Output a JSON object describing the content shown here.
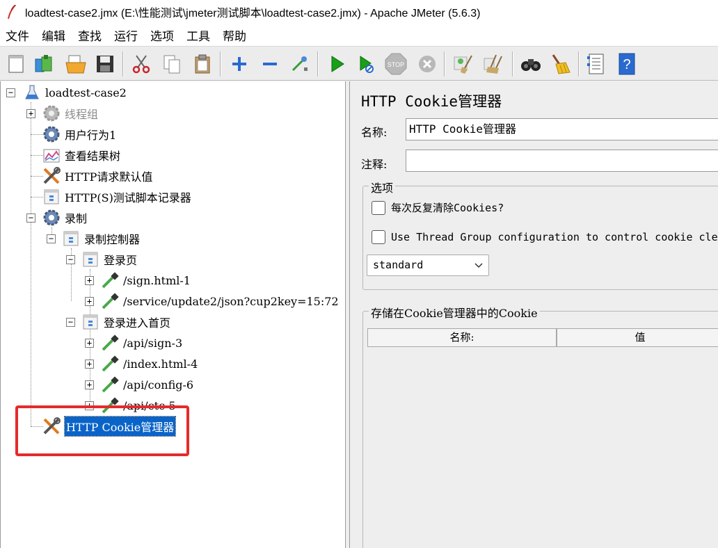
{
  "window": {
    "title": "loadtest-case2.jmx (E:\\性能测试\\jmeter测试脚本\\loadtest-case2.jmx) - Apache JMeter (5.6.3)"
  },
  "menu": [
    "文件",
    "编辑",
    "查找",
    "运行",
    "选项",
    "工具",
    "帮助"
  ],
  "toolbar": {
    "buttons": [
      "new-icon",
      "templates-icon",
      "open-icon",
      "save-icon",
      "cut-icon",
      "copy-icon",
      "paste-icon",
      "expand-icon",
      "collapse-icon",
      "toggle-icon",
      "start-icon",
      "start-no-pause-icon",
      "stop-icon",
      "shutdown-icon",
      "clear-icon",
      "clear-all-icon",
      "search-icon",
      "reset-search-icon",
      "function-helper-icon",
      "help-icon"
    ]
  },
  "tree": {
    "root": "loadtest-case2",
    "items": [
      {
        "label": "线程组",
        "icon": "gear-icon",
        "disabled": true
      },
      {
        "label": "用户行为1",
        "icon": "gear-icon"
      },
      {
        "label": "查看结果树",
        "icon": "chart-icon"
      },
      {
        "label": "HTTP请求默认值",
        "icon": "wrench-icon"
      },
      {
        "label": "HTTP(S)测试脚本记录器",
        "icon": "document-icon"
      },
      {
        "label": "录制",
        "icon": "gear-icon"
      },
      {
        "label": "录制控制器",
        "icon": "controller-icon"
      },
      {
        "label": "登录页",
        "icon": "controller-icon"
      },
      {
        "label": "/sign.html-1",
        "icon": "pipette-icon"
      },
      {
        "label": "/service/update2/json?cup2key=15:72",
        "icon": "pipette-icon"
      },
      {
        "label": "登录进入首页",
        "icon": "controller-icon"
      },
      {
        "label": "/api/sign-3",
        "icon": "pipette-icon"
      },
      {
        "label": "/index.html-4",
        "icon": "pipette-icon"
      },
      {
        "label": "/api/config-6",
        "icon": "pipette-icon"
      },
      {
        "label": "/api/ctc-5",
        "icon": "pipette-icon"
      },
      {
        "label": "HTTP Cookie管理器",
        "icon": "wrench-icon",
        "selected": true
      }
    ]
  },
  "panel": {
    "title": "HTTP Cookie管理器",
    "name_label": "名称:",
    "name_value": "HTTP Cookie管理器",
    "comment_label": "注释:",
    "comment_value": "",
    "options_legend": "选项",
    "clear_each_iteration": "每次反复清除Cookies?",
    "use_thread_group": "Use Thread Group configuration to control cookie clea",
    "policy": "standard",
    "cookies_legend": "存储在Cookie管理器中的Cookie",
    "columns": [
      "名称:",
      "值"
    ]
  },
  "colors": {
    "selection": "#0a64c8",
    "highlight_border": "#e52b2b"
  }
}
